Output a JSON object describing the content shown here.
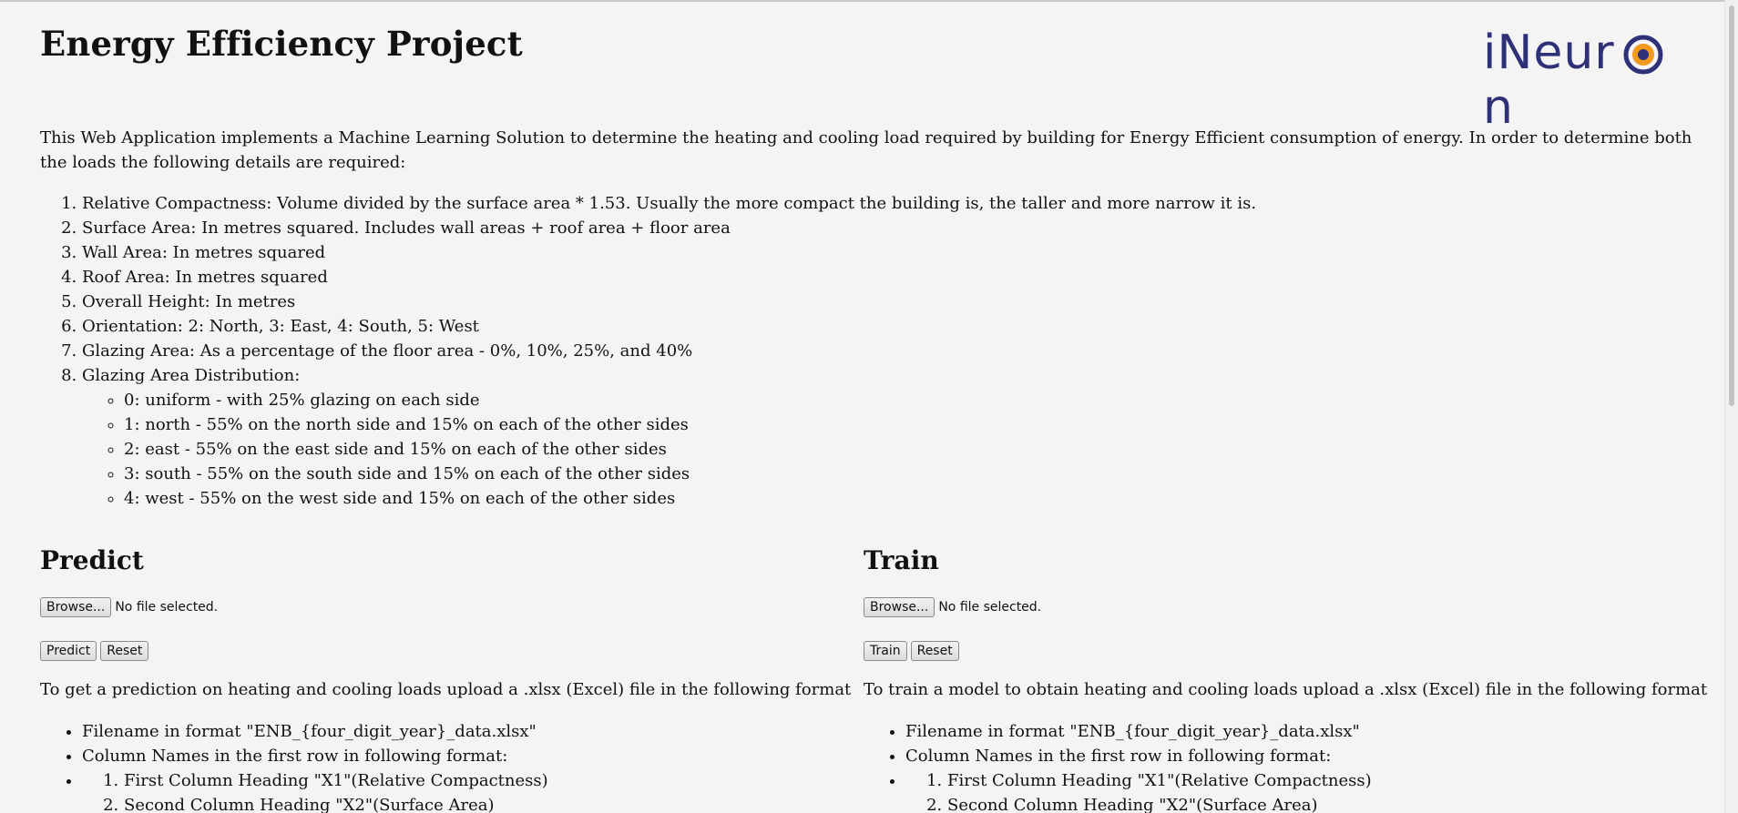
{
  "header": {
    "title": "Energy Efficiency Project",
    "logo_text": "iNeur",
    "logo_text_end": "n"
  },
  "intro": "This Web Application implements a Machine Learning Solution to determine the heating and cooling load required by building for Energy Efficient consumption of energy. In order to determine both the loads the following details are required:",
  "details": [
    "Relative Compactness: Volume divided by the surface area * 1.53. Usually the more compact the building is, the taller and more narrow it is.",
    "Surface Area: In metres squared. Includes wall areas + roof area + floor area",
    "Wall Area: In metres squared",
    "Roof Area: In metres squared",
    "Overall Height: In metres",
    "Orientation: 2: North, 3: East, 4: South, 5: West",
    "Glazing Area: As a percentage of the floor area - 0%, 10%, 25%, and 40%",
    "Glazing Area Distribution:"
  ],
  "distribution": [
    "0: uniform - with 25% glazing on each side",
    "1: north - 55% on the north side and 15% on each of the other sides",
    "2: east - 55% on the east side and 15% on each of the other sides",
    "3: south - 55% on the south side and 15% on each of the other sides",
    "4: west - 55% on the west side and 15% on each of the other sides"
  ],
  "predict": {
    "heading": "Predict",
    "browse_label": "Browse...",
    "file_status": "No file selected.",
    "action_label": "Predict",
    "reset_label": "Reset",
    "description": "To get a prediction on heating and cooling loads upload a .xlsx (Excel) file in the following format",
    "filename_item": "Filename in format \"ENB_{four_digit_year}_data.xlsx\"",
    "columns_item": "Column Names in the first row in following format:",
    "columns": [
      "First Column Heading \"X1\"(Relative Compactness)",
      "Second Column Heading \"X2\"(Surface Area)"
    ]
  },
  "train": {
    "heading": "Train",
    "browse_label": "Browse...",
    "file_status": "No file selected.",
    "action_label": "Train",
    "reset_label": "Reset",
    "description": "To train a model to obtain heating and cooling loads upload a .xlsx (Excel) file in the following format",
    "filename_item": "Filename in format \"ENB_{four_digit_year}_data.xlsx\"",
    "columns_item": "Column Names in the first row in following format:",
    "columns": [
      "First Column Heading \"X1\"(Relative Compactness)",
      "Second Column Heading \"X2\"(Surface Area)"
    ]
  },
  "colors": {
    "logo_blue": "#2e3177",
    "logo_orange": "#f39a1e"
  }
}
